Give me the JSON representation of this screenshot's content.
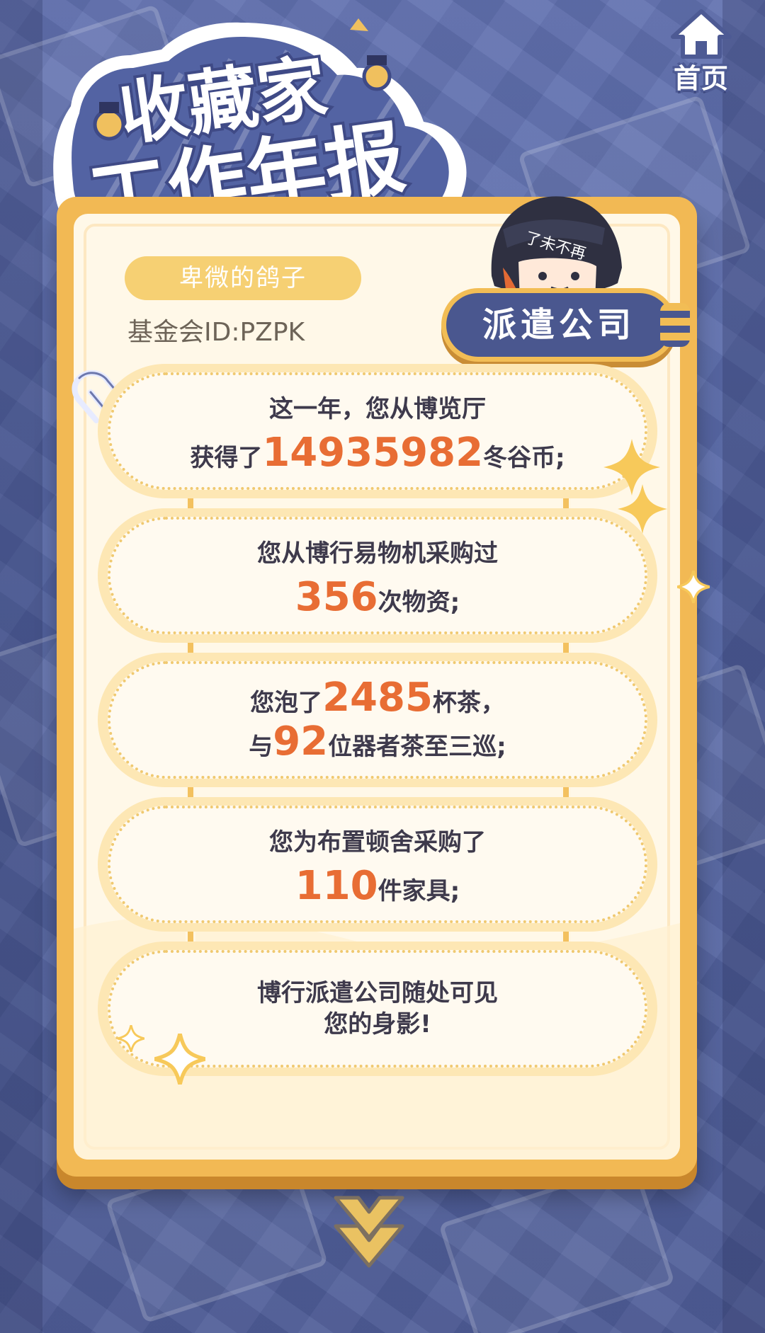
{
  "header": {
    "home_label": "首页",
    "title_line1": "收藏家",
    "title_line2": "工作年报"
  },
  "profile": {
    "nickname": "卑微的鸽子",
    "id_text": "基金会ID:PZPK",
    "company_badge": "派遣公司",
    "avatar_hat_text": "了未不再"
  },
  "stats": [
    {
      "line1_prefix": "这一年，您从博览厅",
      "line2_prefix": "获得了",
      "value": "14935982",
      "line2_suffix": "冬谷币;"
    },
    {
      "line1_prefix": "您从博行易物机采购过",
      "value": "356",
      "line2_suffix": "次物资;"
    },
    {
      "line1_prefix": "您泡了",
      "value1": "2485",
      "line1_suffix": "杯茶，",
      "line2_prefix": "与",
      "value2": "92",
      "line2_suffix": "位器者茶至三巡;"
    },
    {
      "line1_prefix": "您为布置顿舍采购了",
      "value": "110",
      "line2_suffix": "件家具;"
    },
    {
      "line1_prefix": "博行派遣公司随处可见",
      "line2_prefix": "您的身影!"
    }
  ],
  "colors": {
    "background": "#5b6aa8",
    "card_border": "#f2b954",
    "card_fill": "#fff8e8",
    "highlight_number": "#e86d34",
    "badge": "#4a578f"
  },
  "icons": {
    "home": "home-icon",
    "next": "double-chevron-down-icon",
    "clip": "paperclip-icon"
  }
}
